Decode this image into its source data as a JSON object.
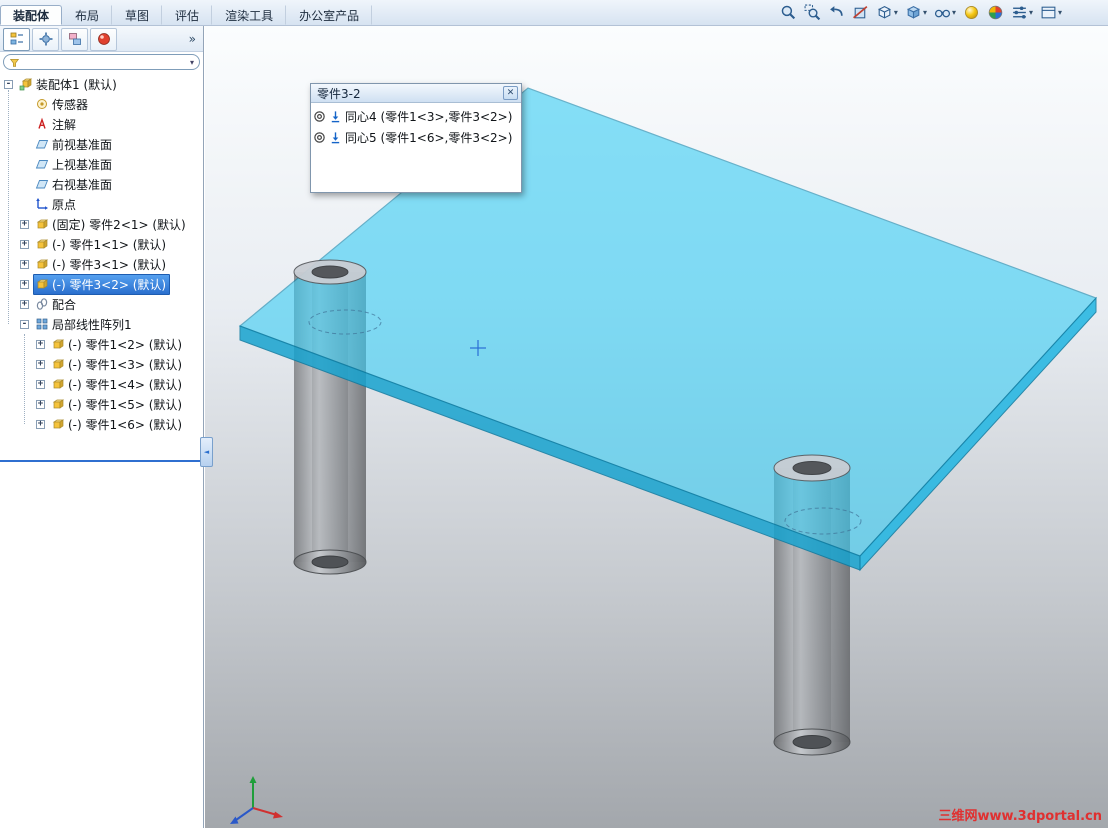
{
  "ribbon": {
    "tabs": [
      "装配体",
      "布局",
      "草图",
      "评估",
      "渲染工具",
      "办公室产品"
    ],
    "active_tab": "装配体"
  },
  "heads_up_toolbar": {
    "icons": [
      {
        "name": "zoom-to-fit",
        "dropdown": false
      },
      {
        "name": "zoom-to-area",
        "dropdown": false
      },
      {
        "name": "previous-view",
        "dropdown": false
      },
      {
        "name": "section-view",
        "dropdown": false
      },
      {
        "name": "view-orientation",
        "dropdown": true
      },
      {
        "name": "display-style",
        "dropdown": true
      },
      {
        "name": "hide-show-items",
        "dropdown": true
      },
      {
        "name": "edit-appearance",
        "dropdown": false
      },
      {
        "name": "apply-scene",
        "dropdown": false
      },
      {
        "name": "view-settings",
        "dropdown": true
      },
      {
        "name": "options",
        "dropdown": true
      }
    ]
  },
  "panel_tabs": {
    "icons": [
      "feature-manager",
      "property-manager",
      "configuration-manager",
      "display-manager"
    ]
  },
  "filter": {
    "value": "",
    "placeholder": ""
  },
  "feature_tree": {
    "items": [
      {
        "label": "装配体1 (默认)",
        "icon": "assembly",
        "expander": "-",
        "depth": 0,
        "selected": false
      },
      {
        "label": "传感器",
        "icon": "sensors",
        "expander": "",
        "depth": 1,
        "selected": false
      },
      {
        "label": "注解",
        "icon": "annotations",
        "expander": "",
        "depth": 1,
        "selected": false
      },
      {
        "label": "前视基准面",
        "icon": "plane",
        "expander": "",
        "depth": 1,
        "selected": false
      },
      {
        "label": "上视基准面",
        "icon": "plane",
        "expander": "",
        "depth": 1,
        "selected": false
      },
      {
        "label": "右视基准面",
        "icon": "plane",
        "expander": "",
        "depth": 1,
        "selected": false
      },
      {
        "label": "原点",
        "icon": "origin",
        "expander": "",
        "depth": 1,
        "selected": false
      },
      {
        "label": "(固定) 零件2<1> (默认)",
        "icon": "part",
        "expander": "+",
        "depth": 1,
        "selected": false
      },
      {
        "label": "(-) 零件1<1> (默认)",
        "icon": "part",
        "expander": "+",
        "depth": 1,
        "selected": false
      },
      {
        "label": "(-) 零件3<1> (默认)",
        "icon": "part",
        "expander": "+",
        "depth": 1,
        "selected": false
      },
      {
        "label": "(-) 零件3<2> (默认)",
        "icon": "part",
        "expander": "+",
        "depth": 1,
        "selected": true
      },
      {
        "label": "配合",
        "icon": "mates",
        "expander": "+",
        "depth": 1,
        "selected": false
      },
      {
        "label": "局部线性阵列1",
        "icon": "pattern",
        "expander": "-",
        "depth": 1,
        "selected": false
      },
      {
        "label": "(-) 零件1<2> (默认)",
        "icon": "part",
        "expander": "+",
        "depth": 2,
        "selected": false
      },
      {
        "label": "(-) 零件1<3> (默认)",
        "icon": "part",
        "expander": "+",
        "depth": 2,
        "selected": false
      },
      {
        "label": "(-) 零件1<4> (默认)",
        "icon": "part",
        "expander": "+",
        "depth": 2,
        "selected": false
      },
      {
        "label": "(-) 零件1<5> (默认)",
        "icon": "part",
        "expander": "+",
        "depth": 2,
        "selected": false
      },
      {
        "label": "(-) 零件1<6> (默认)",
        "icon": "part",
        "expander": "+",
        "depth": 2,
        "selected": false
      }
    ]
  },
  "popup": {
    "title": "零件3-2",
    "items": [
      {
        "icon": "concentric-mate",
        "label": "同心4 (零件1<3>,零件3<2>)"
      },
      {
        "icon": "concentric-mate",
        "label": "同心5 (零件1<6>,零件3<2>)"
      }
    ]
  },
  "viewport": {
    "watermark": "三维网www.3dportal.cn",
    "model": "table assembly: transparent blue top plate with gray tubular legs"
  },
  "glyphs": {
    "caret": "▾",
    "overflow_chevron": "»",
    "close": "✕",
    "splitter_arrow": "◄"
  },
  "colors": {
    "plate_blue": "#39cdf4",
    "selection_blue": "#2a6fce",
    "watermark_red": "#e03030",
    "leg_gray": "#8d9094"
  }
}
